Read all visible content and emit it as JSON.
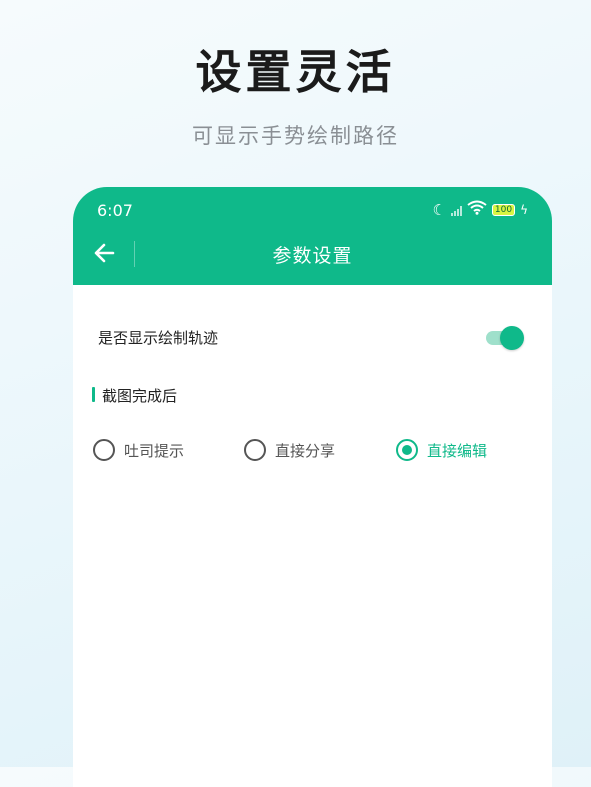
{
  "promo": {
    "title": "设置灵活",
    "subtitle": "可显示手势绘制路径"
  },
  "status_bar": {
    "time": "6:07",
    "battery": "100",
    "icons": [
      "moon-icon",
      "signal-icon",
      "wifi-icon",
      "battery-icon",
      "charging-icon"
    ]
  },
  "appbar": {
    "title": "参数设置",
    "back_icon": "arrow-left-icon"
  },
  "settings": {
    "show_trail_label": "是否显示绘制轨迹",
    "show_trail_enabled": true,
    "section_title": "截图完成后",
    "options": [
      {
        "label": "吐司提示",
        "selected": false
      },
      {
        "label": "直接分享",
        "selected": false
      },
      {
        "label": "直接编辑",
        "selected": true
      }
    ]
  },
  "colors": {
    "accent": "#0fb98a",
    "switch_track": "#9fe0cb",
    "text_primary": "#222222",
    "text_secondary": "#8a8f94"
  }
}
